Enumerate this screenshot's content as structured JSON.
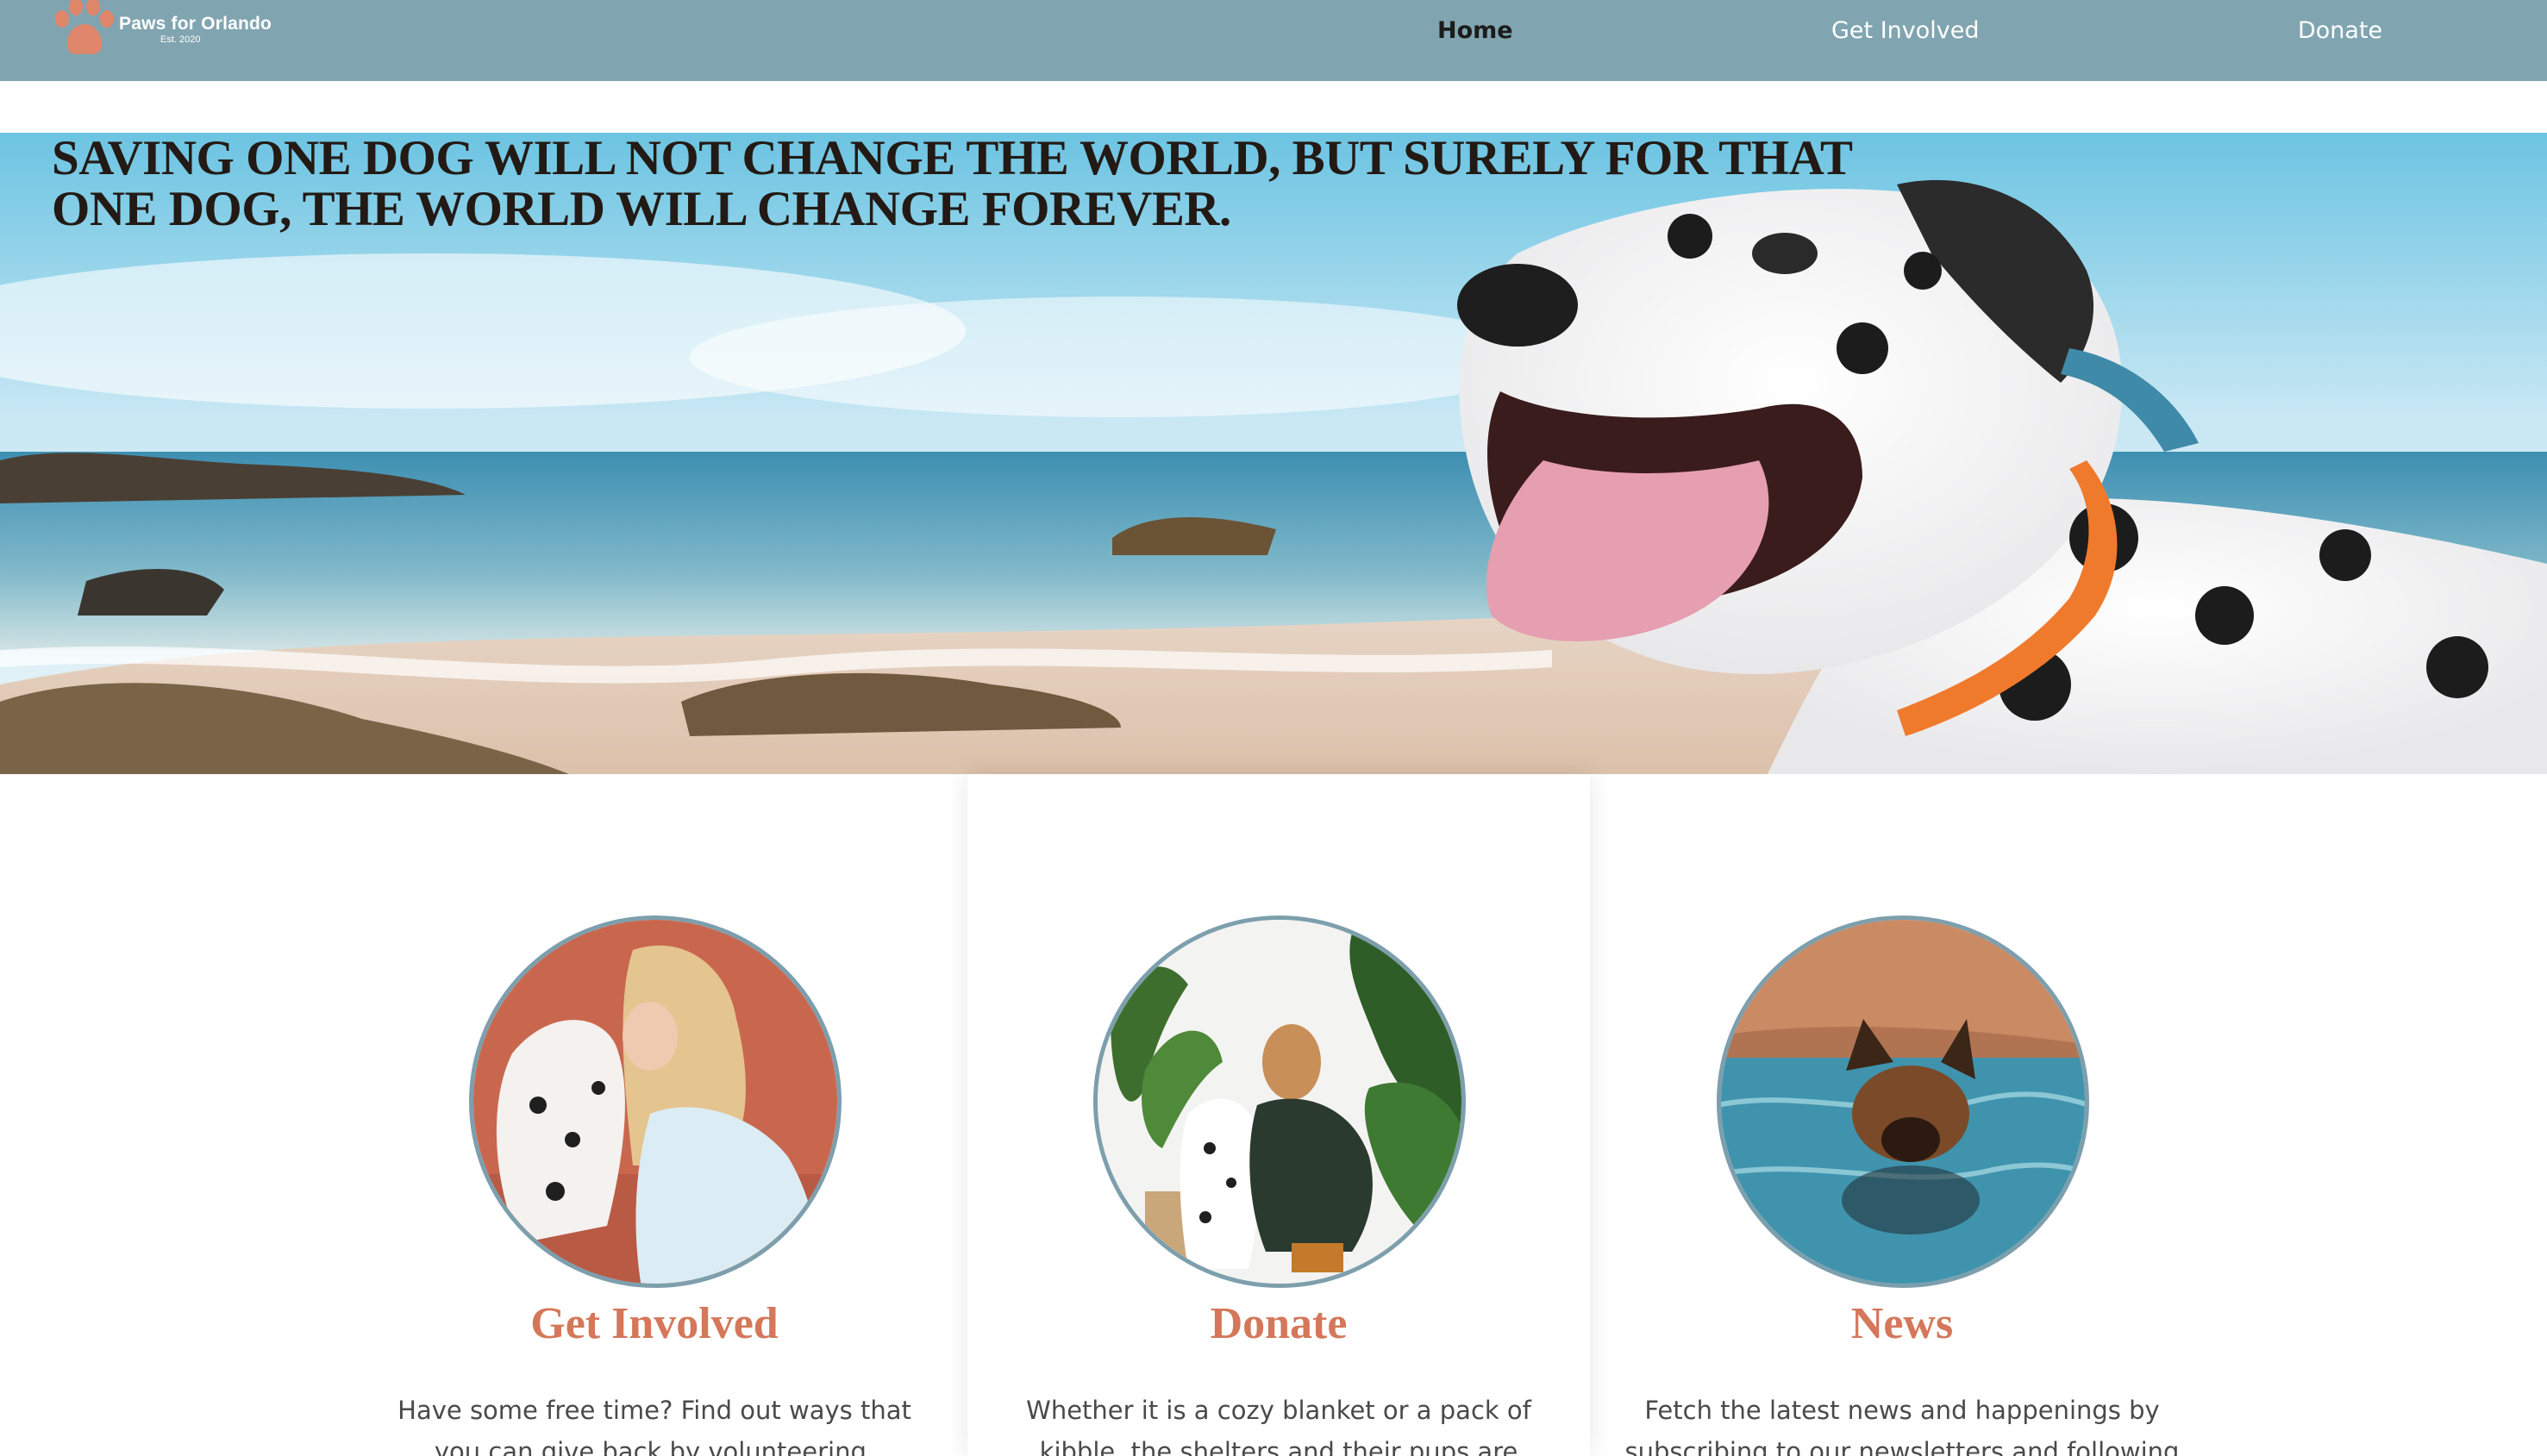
{
  "brand": {
    "name": "Paws for Orlando",
    "tagline": "Est. 2020",
    "logo_icon": "paw-print-icon",
    "logo_color": "#e0866a"
  },
  "nav": {
    "background": "#81a5b0",
    "items": [
      {
        "label": "Home",
        "active": true
      },
      {
        "label": "Get Involved",
        "active": false
      },
      {
        "label": "Donate",
        "active": false
      }
    ]
  },
  "hero": {
    "quote": "SAVING ONE DOG WILL NOT CHANGE THE WORLD, BUT SURELY FOR THAT ONE DOG, THE WORLD WILL CHANGE FOREVER.",
    "image": "dalmatian-on-beach"
  },
  "cards": [
    {
      "title": "Get Involved",
      "text": "Have some free time? Find out ways that you can give back by volunteering, adopting, or fostering a",
      "image": "woman-kissing-dalmatian"
    },
    {
      "title": "Donate",
      "text": "Whether it is a cozy blanket or a pack of kibble, the shelters and their pups are graciously",
      "image": "woman-with-dalmatian-and-plants"
    },
    {
      "title": "News",
      "text": "Fetch the latest news and happenings by subscribing to our newsletters and following us",
      "image": "german-shepherd-swimming"
    }
  ],
  "colors": {
    "accent": "#d4775a",
    "circle_border": "#7d9fad",
    "quote_text": "#231a15"
  }
}
